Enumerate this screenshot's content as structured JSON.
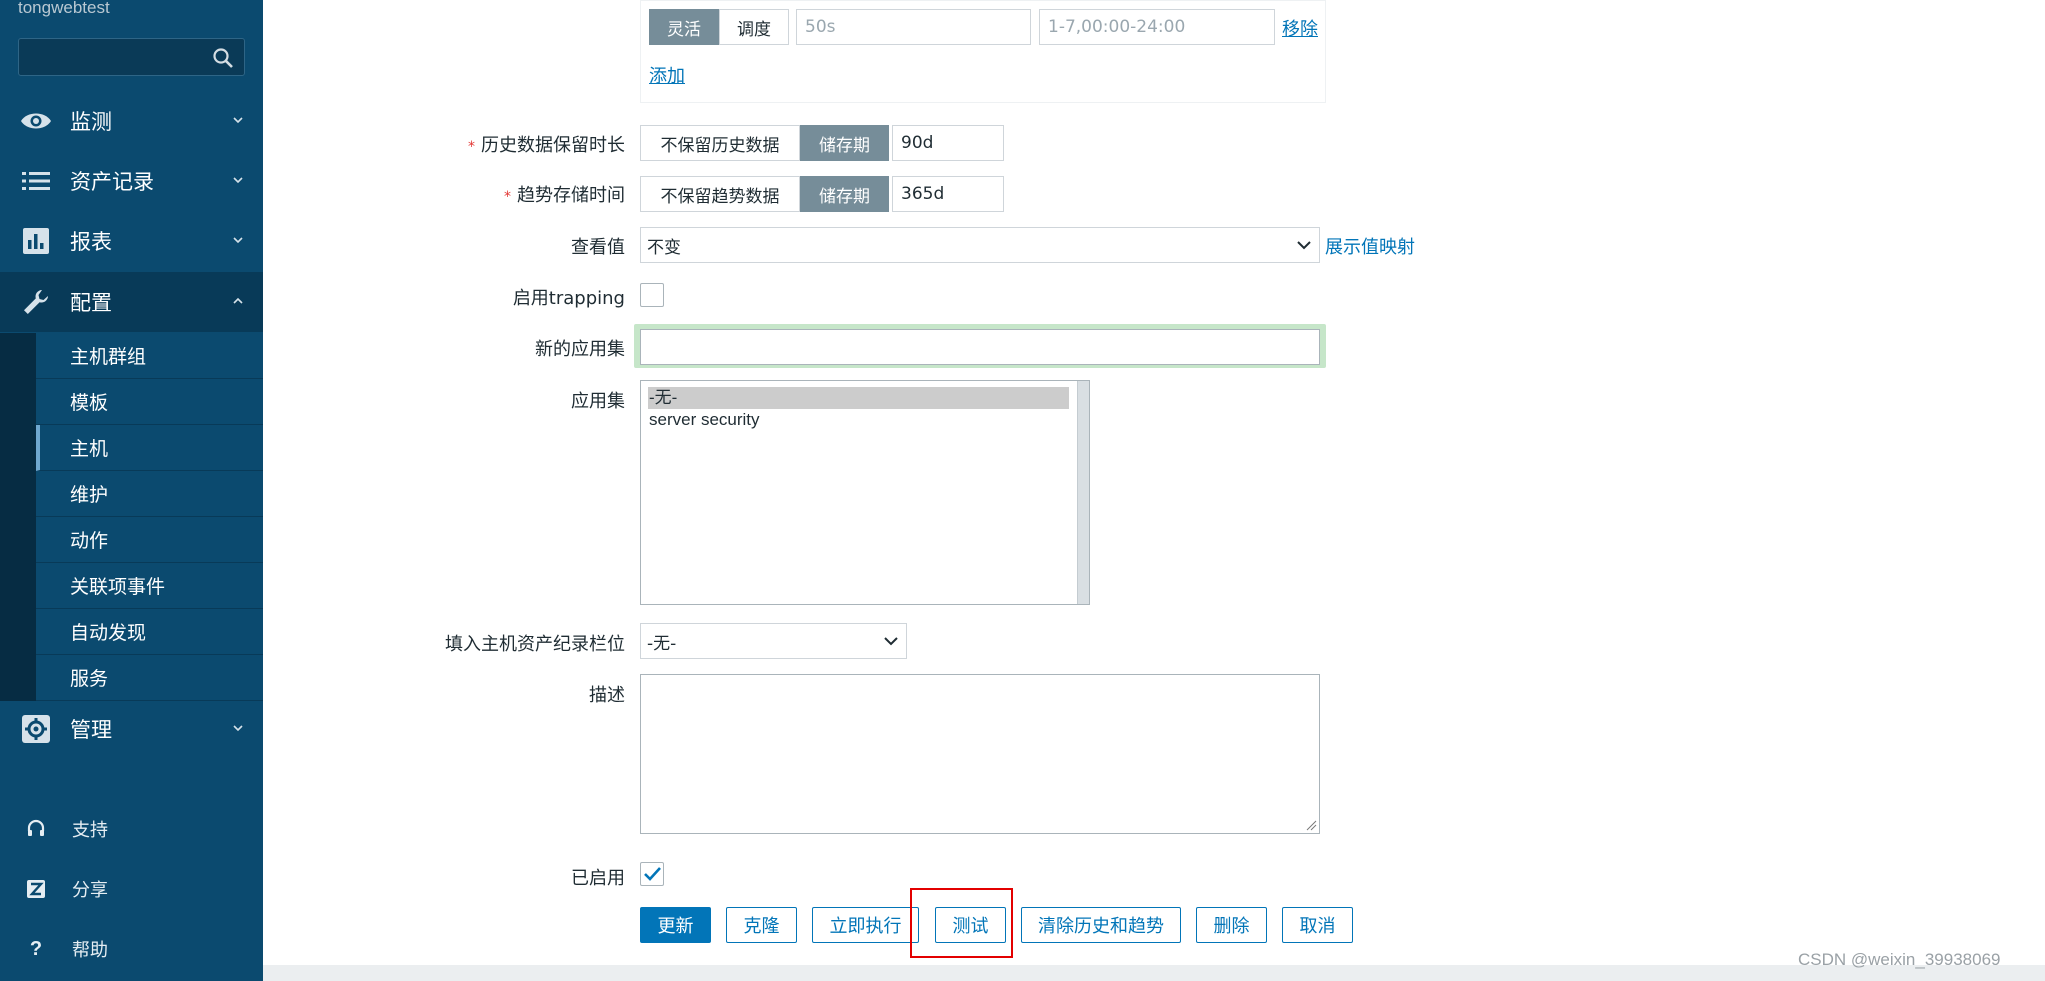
{
  "sidebar": {
    "brand": "tongwebtest",
    "nav": [
      {
        "label": "监测",
        "icon": "eye-icon"
      },
      {
        "label": "资产记录",
        "icon": "list-icon"
      },
      {
        "label": "报表",
        "icon": "bar-chart-icon"
      },
      {
        "label": "配置",
        "icon": "wrench-icon"
      },
      {
        "label": "管理",
        "icon": "gear-icon"
      }
    ],
    "submenu": [
      "主机群组",
      "模板",
      "主机",
      "维护",
      "动作",
      "关联项事件",
      "自动发现",
      "服务"
    ],
    "bottom": [
      {
        "label": "支持",
        "icon": "headset-icon"
      },
      {
        "label": "分享",
        "icon": "share-z-icon"
      },
      {
        "label": "帮助",
        "icon": "help-icon"
      }
    ]
  },
  "interval": {
    "mode_flexible": "灵活",
    "mode_schedule": "调度",
    "delay_placeholder": "50s",
    "period_placeholder": "1-7,00:00-24:00",
    "remove": "移除",
    "add": "添加"
  },
  "history": {
    "label": "历史数据保留时长",
    "opt_none": "不保留历史数据",
    "opt_storage": "储存期",
    "value": "90d"
  },
  "trends": {
    "label": "趋势存储时间",
    "opt_none": "不保留趋势数据",
    "opt_storage": "储存期",
    "value": "365d"
  },
  "valuemap": {
    "label": "查看值",
    "value": "不变",
    "link": "展示值映射"
  },
  "trapping": {
    "label": "启用trapping"
  },
  "new_app": {
    "label": "新的应用集",
    "value": ""
  },
  "apps": {
    "label": "应用集",
    "options": [
      "-无-",
      "server security"
    ]
  },
  "inventory": {
    "label": "填入主机资产纪录栏位",
    "value": "-无-"
  },
  "description": {
    "label": "描述"
  },
  "enabled": {
    "label": "已启用"
  },
  "buttons": {
    "update": "更新",
    "clone": "克隆",
    "execute": "立即执行",
    "test": "测试",
    "clear": "清除历史和趋势",
    "delete": "删除",
    "cancel": "取消"
  },
  "watermark": "CSDN @weixin_39938069",
  "colors": {
    "sidebar": "#0b4a6f",
    "accent": "#0275b8",
    "segment_on": "#768d99",
    "highlight": "#e30000"
  }
}
